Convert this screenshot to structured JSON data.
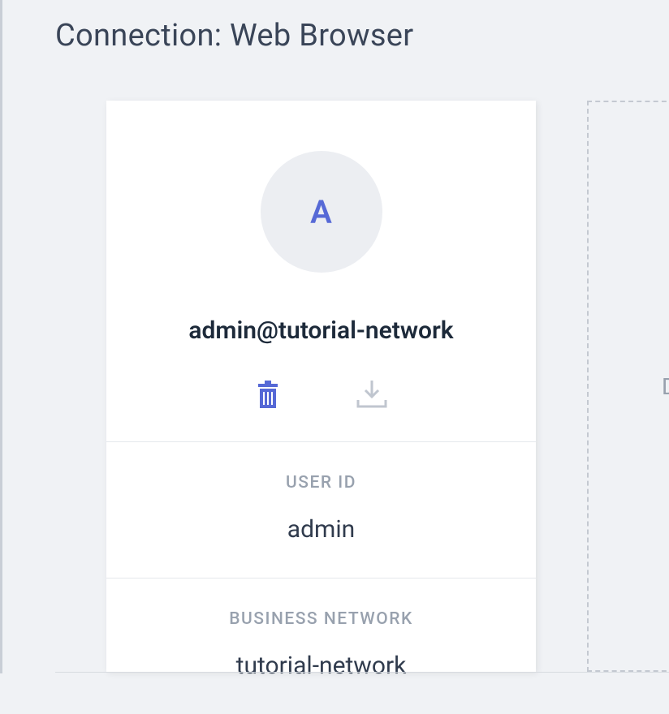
{
  "page": {
    "title": "Connection: Web Browser"
  },
  "card": {
    "avatar_letter": "A",
    "identity": "admin@tutorial-network",
    "actions": {
      "delete_icon": "trash-icon",
      "download_icon": "download-icon"
    },
    "sections": {
      "user_id": {
        "label": "USER ID",
        "value": "admin"
      },
      "business_network": {
        "label": "BUSINESS NETWORK",
        "value": "tutorial-network"
      }
    }
  },
  "drop": {
    "text_fragment": "D"
  }
}
